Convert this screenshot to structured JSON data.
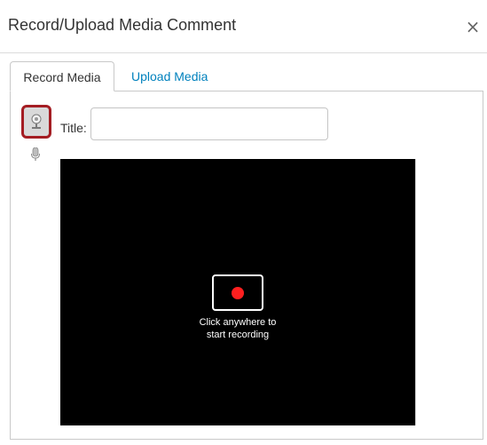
{
  "dialog": {
    "title": "Record/Upload Media Comment",
    "close_glyph": "×"
  },
  "tabs": [
    {
      "label": "Record Media",
      "active": true
    },
    {
      "label": "Upload Media",
      "active": false
    }
  ],
  "form": {
    "title_label": "Title:",
    "title_value": "",
    "title_placeholder": ""
  },
  "recorder": {
    "hint_line1": "Click anywhere to",
    "hint_line2": "start recording"
  },
  "icons": {
    "webcam": "webcam-icon",
    "microphone": "microphone-icon",
    "record": "record-dot-icon"
  },
  "colors": {
    "link": "#0081bd",
    "record_dot": "#ff1f1f",
    "webcam_border": "#a41d23"
  }
}
